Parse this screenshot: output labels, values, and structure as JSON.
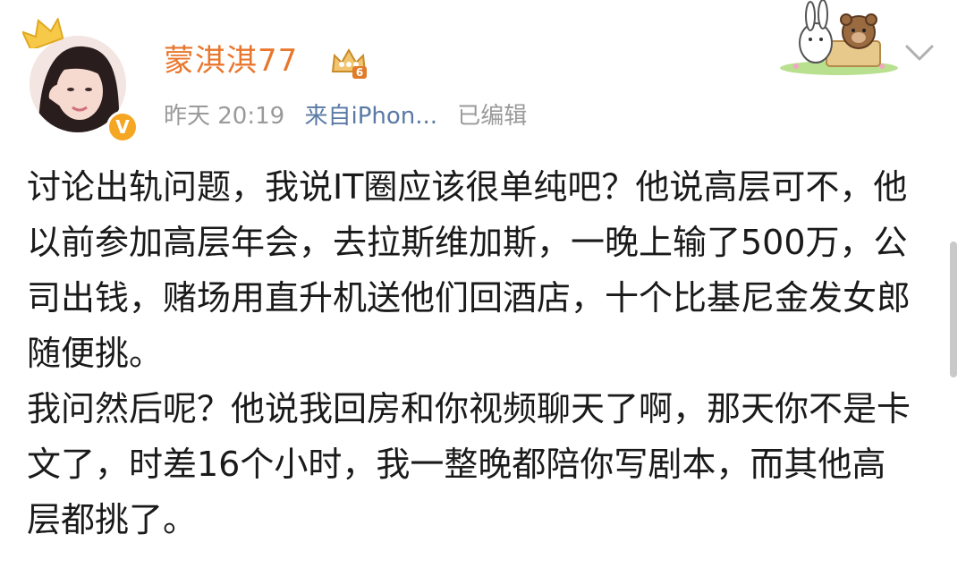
{
  "user": {
    "name": "蒙淇淇77",
    "vip_level": "6",
    "verified_mark": "V"
  },
  "meta": {
    "time": "昨天 20:19",
    "source": "来自iPhon...",
    "edited": "已编辑"
  },
  "post": {
    "paragraphs": [
      "讨论出轨问题，我说IT圈应该很单纯吧？他说高层可不，他以前参加高层年会，去拉斯维加斯，一晚上输了500万，公司出钱，赌场用直升机送他们回酒店，十个比基尼金发女郎随便挑。",
      "我问然后呢？他说我回房和你视频聊天了啊，那天你不是卡文了，时差16个小时，我一整晚都陪你写剧本，而其他高层都挑了。"
    ]
  },
  "colors": {
    "username": "#e8772e",
    "meta": "#9a9a9a",
    "body_text": "#1a1a1a",
    "badge": "#f5a623"
  },
  "icons": {
    "crown": "crown-icon",
    "vip": "vip-crown-icon",
    "verified": "verified-badge-icon",
    "dropdown": "chevron-down-icon",
    "sticker": "rabbit-bear-sticker-icon"
  }
}
